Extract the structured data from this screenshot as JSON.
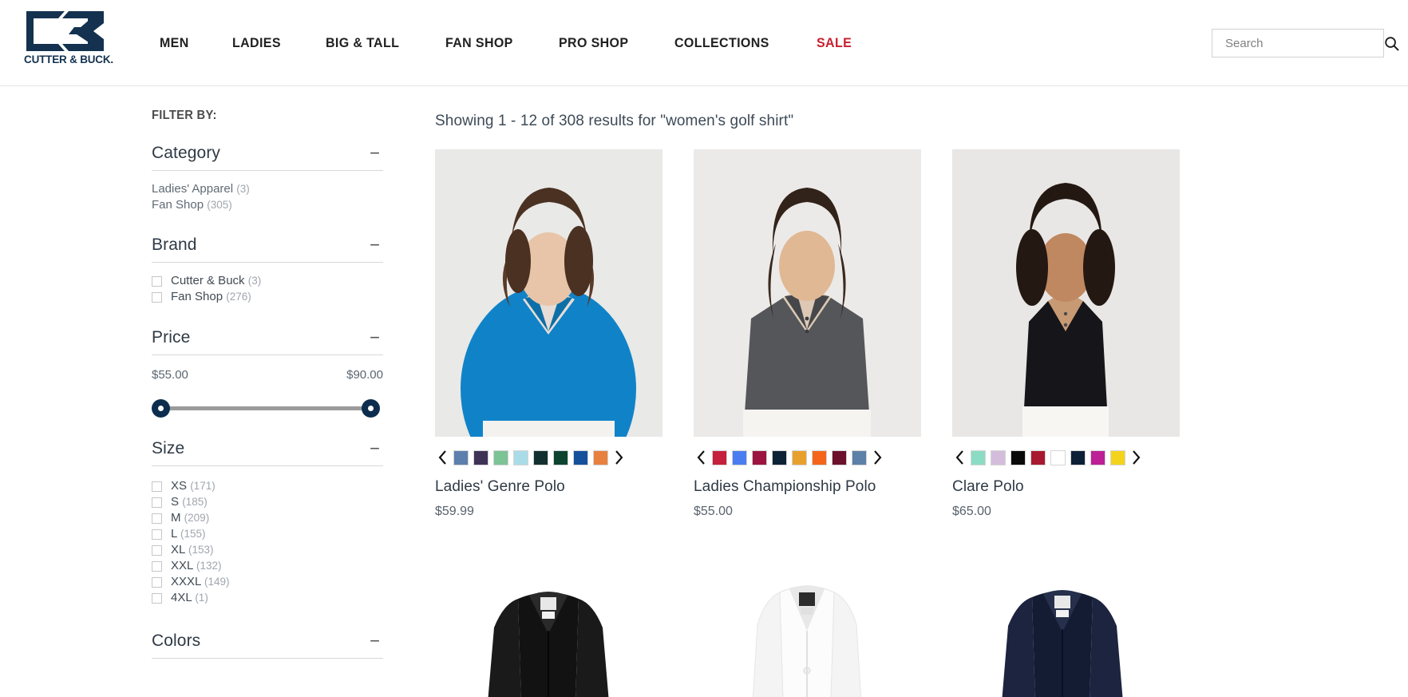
{
  "header": {
    "logo_word": "CUTTER & BUCK.",
    "nav": [
      {
        "label": "MEN"
      },
      {
        "label": "LADIES"
      },
      {
        "label": "BIG & TALL"
      },
      {
        "label": "FAN SHOP"
      },
      {
        "label": "PRO SHOP"
      },
      {
        "label": "COLLECTIONS"
      },
      {
        "label": "SALE"
      }
    ],
    "search": {
      "placeholder": "Search",
      "value": "",
      "icon": "search-icon"
    },
    "sale_color": "#c8202f"
  },
  "sidebar": {
    "title": "FILTER BY:",
    "facets": [
      {
        "name": "Category",
        "toggle": "−",
        "links": [
          {
            "label": "Ladies' Apparel",
            "count": "(3)"
          },
          {
            "label": "Fan Shop",
            "count": "(305)"
          }
        ]
      },
      {
        "name": "Brand",
        "toggle": "−",
        "checkboxes": [
          {
            "label": "Cutter & Buck",
            "count": "(3)"
          },
          {
            "label": "Fan Shop",
            "count": "(276)"
          }
        ]
      },
      {
        "name": "Price",
        "toggle": "−",
        "min_label": "$55.00",
        "max_label": "$90.00"
      },
      {
        "name": "Size",
        "toggle": "−",
        "checkboxes": [
          {
            "label": "XS",
            "count": "(171)"
          },
          {
            "label": "S",
            "count": "(185)"
          },
          {
            "label": "M",
            "count": "(209)"
          },
          {
            "label": "L",
            "count": "(155)"
          },
          {
            "label": "XL",
            "count": "(153)"
          },
          {
            "label": "XXL",
            "count": "(132)"
          },
          {
            "label": "XXXL",
            "count": "(149)"
          },
          {
            "label": "4XL",
            "count": "(1)"
          }
        ]
      },
      {
        "name": "Colors",
        "toggle": "−"
      }
    ]
  },
  "results": {
    "summary": "Showing 1 - 12 of 308 results for \"women's golf shirt\"",
    "prev_arrow": "‹",
    "next_arrow": "›",
    "products": [
      {
        "name": "Ladies' Genre Polo",
        "price": "$59.99",
        "shirt_color": "#1083c8",
        "image_kind": "model",
        "swatches": [
          "#5c7fad",
          "#3e3357",
          "#7cc396",
          "#aadce8",
          "#12302f",
          "#0c4430",
          "#14509c",
          "#e8803f"
        ]
      },
      {
        "name": "Ladies Championship Polo",
        "price": "$55.00",
        "shirt_color": "#54565a",
        "image_kind": "model",
        "swatches": [
          "#c5203c",
          "#4a7ef0",
          "#9c1540",
          "#0d2335",
          "#e8a02c",
          "#f4651b",
          "#6b112c",
          "#5c80a8"
        ]
      },
      {
        "name": "Clare Polo",
        "price": "$65.00",
        "shirt_color": "#16161a",
        "image_kind": "model-sleeveless",
        "swatches": [
          "#8cdcc4",
          "#d4bcdc",
          "#0a0a0a",
          "#a81830",
          "#ffffff",
          "#0c2038",
          "#bc1f96",
          "#f4d31c"
        ]
      }
    ],
    "row2_products": [
      {
        "shirt_color": "#121212",
        "image_kind": "flat"
      },
      {
        "shirt_color": "#fcfcfc",
        "image_kind": "flat"
      },
      {
        "shirt_color": "#141c33",
        "image_kind": "flat"
      }
    ]
  }
}
